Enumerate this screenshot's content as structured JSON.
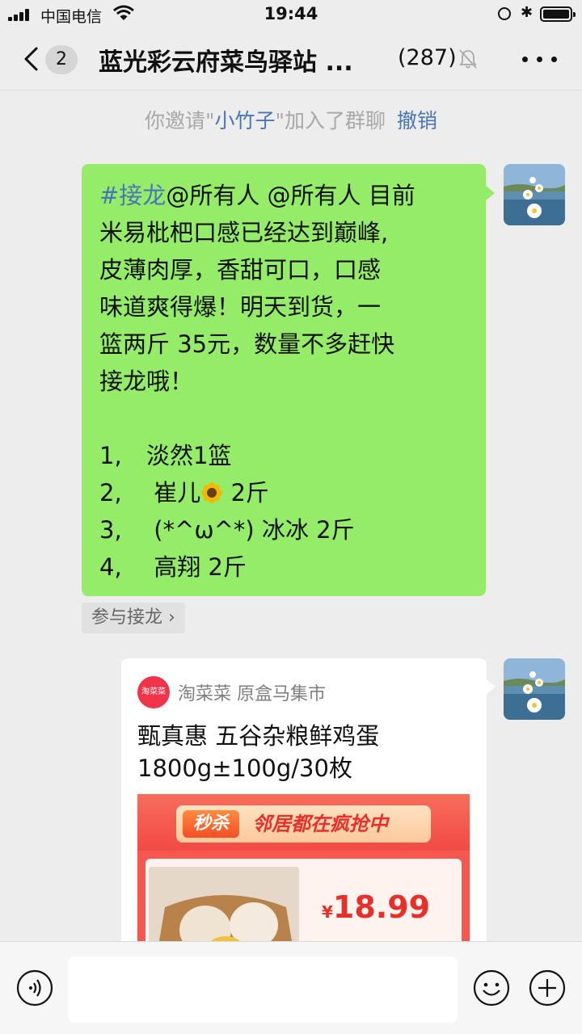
{
  "status": {
    "carrier": "中国电信",
    "time": "19:44"
  },
  "nav": {
    "back_count": "2",
    "title": "蓝光彩云府菜鸟驿站 ...",
    "member_count": "(287)"
  },
  "system_message": {
    "prefix": "你邀请\"",
    "name": "小竹子",
    "suffix": "\"加入了群聊",
    "revoke": "撤销"
  },
  "message": {
    "tag": "#接龙",
    "lines": [
      "@所有人 @所有人 目前",
      "米易枇杷口感已经达到巅峰,",
      "皮薄肉厚，香甜可口，口感",
      "味道爽得爆！明天到货，一",
      "篮两斤 35元，数量不多赶快",
      "接龙哦！"
    ],
    "list": [
      {
        "num": "1,",
        "text": "淡然1篮"
      },
      {
        "num": "2,",
        "pre": "崔儿",
        "post": " 2斤"
      },
      {
        "num": "3,",
        "text": "(*^ω^*) 冰冰 2斤"
      },
      {
        "num": "4,",
        "text": "高翔 2斤"
      }
    ],
    "join_label": "参与接龙 ›"
  },
  "card": {
    "logo_text": "淘菜菜",
    "shop": "淘菜菜  原盒马集市",
    "title_line1": "甄真惠 五谷杂粮鲜鸡蛋",
    "title_line2": "1800g±100g/30枚",
    "banner_tag": "秒杀",
    "banner_slogan": "邻居都在疯抢中",
    "currency": "¥",
    "price": "18.99"
  },
  "colors": {
    "bubble": "#95ec69",
    "link": "#4a76b8",
    "background": "#ededed"
  }
}
